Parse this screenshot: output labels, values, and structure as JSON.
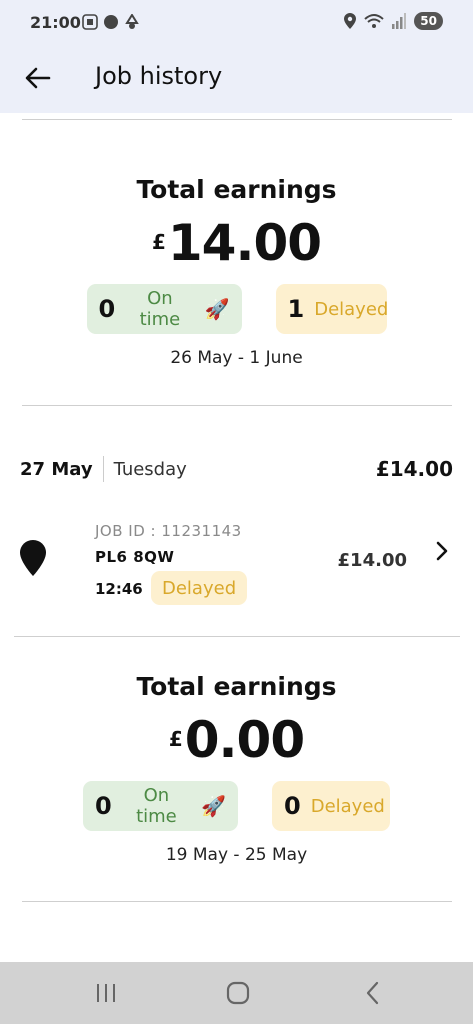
{
  "status_bar": {
    "time": "21:00",
    "battery": "50"
  },
  "header": {
    "title": "Job history",
    "back_icon": "arrow-left-icon"
  },
  "weeks": [
    {
      "title": "Total earnings",
      "currency": "£",
      "amount": "14.00",
      "on_time_count": "0",
      "on_time_label": "On time",
      "on_time_emoji": "🚀",
      "delayed_count": "1",
      "delayed_label": "Delayed",
      "range": "26 May - 1 June"
    },
    {
      "title": "Total earnings",
      "currency": "£",
      "amount": "0.00",
      "on_time_count": "0",
      "on_time_label": "On time",
      "on_time_emoji": "🚀",
      "delayed_count": "0",
      "delayed_label": "Delayed",
      "range": "19 May - 25 May"
    }
  ],
  "day": {
    "date": "27 May",
    "weekday": "Tuesday",
    "total": "£14.00"
  },
  "job": {
    "id_label": "JOB ID : 11231143",
    "postcode": "PL6 8QW",
    "time": "12:46",
    "status": "Delayed",
    "amount": "£14.00"
  },
  "colors": {
    "header_bg": "#eceff9",
    "on_time_bg": "#e1efdf",
    "on_time_text": "#4d8a45",
    "delayed_bg": "#fdf0cf",
    "delayed_text": "#d9a82b",
    "nav_bg": "#d2d2d2"
  }
}
